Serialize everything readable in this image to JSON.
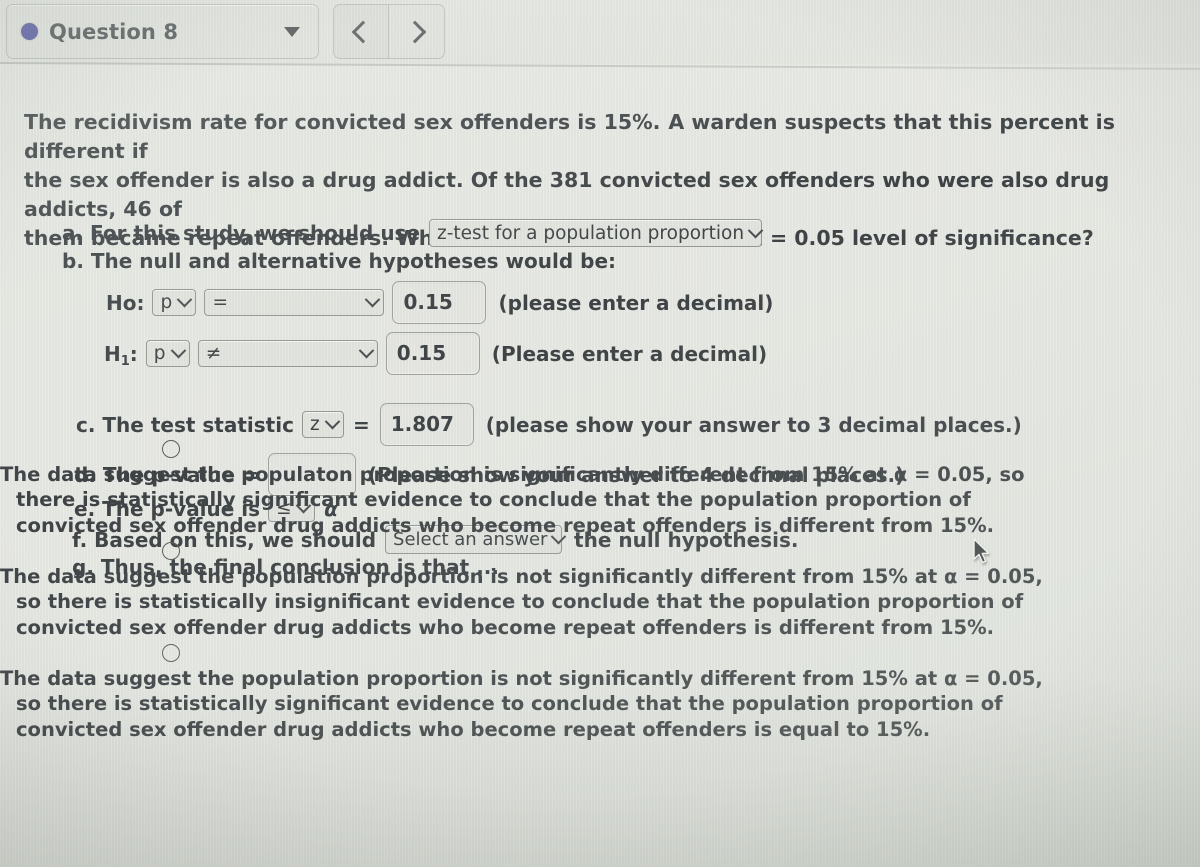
{
  "toolbar": {
    "question_label": "Question 8",
    "dot_color": "#3b3f96",
    "caret_icon": "chevron-down-icon",
    "prev_label": "‹",
    "next_label": "›"
  },
  "question": {
    "stem_line1": "The recidivism rate for convicted sex offenders is 15%.",
    "stem_line1b": "A warden suspects that this percent is different if",
    "stem_line2": "the sex offender is also a drug addict. Of the 381 convicted sex offenders who were also drug addicts, 46 of",
    "stem_line3": "them became repeat offenders. What can be concluded at the α = 0.05 level of significance?"
  },
  "parts": {
    "a": {
      "label": "a. For this study, we should use",
      "test_select_value": "z-test for a population proportion"
    },
    "b": {
      "label": "b. The null and alternative hypotheses would be:",
      "ho_label": "Ho:",
      "ho_param": "p",
      "ho_operator": "=",
      "ho_value": "0.15",
      "ho_hint": "(please enter a decimal)",
      "h1_label": "H",
      "h1_sub": "1",
      "h1_colon": ":",
      "h1_param": "p",
      "h1_operator": "≠",
      "h1_value": "0.15",
      "h1_hint": "(Please enter a decimal)"
    },
    "c": {
      "label": "c. The test statistic",
      "stat_select_value": "z",
      "equals": "=",
      "value": "1.807",
      "hint": "(please show your answer to 3 decimal places.)"
    },
    "d": {
      "label": "d. The p-value =",
      "value": "",
      "hint": "(Please show your answer to 4 decimal places.)"
    },
    "e": {
      "label": "e. The p-value is",
      "ineq_select_value": "≤",
      "alpha": "α"
    },
    "f": {
      "label_before": "f. Based on this, we should",
      "answer_select_value": "Select an answer",
      "label_after": "the null hypothesis."
    },
    "g": {
      "label": "g. Thus, the final conclusion is that ..."
    }
  },
  "choices": [
    {
      "line1_a": "The data suggest the populaton proportion is ",
      "line1_bold": "significantly",
      "line1_b": " different from 15% at α = 0.05, so",
      "line2": "there is statistically significant evidence to conclude that the population proportion of",
      "line3": "convicted sex offender drug addicts who become repeat offenders is different from 15%."
    },
    {
      "line1_a": "The data suggest the population proportion is not ",
      "line1_bold": "significantly",
      "line1_b": " different from 15% at α = 0.05,",
      "line2": "so there is statistically insignificant evidence to conclude that the population proportion of",
      "line3": "convicted sex offender drug addicts who become repeat offenders is different from 15%."
    },
    {
      "line1_a": "The data suggest the population proportion is not ",
      "line1_bold": "significantly",
      "line1_b": " different from 15% at α = 0.05,",
      "line2": "so there is statistically significant evidence to conclude that the population proportion of",
      "line3": "convicted sex offender drug addicts who become repeat offenders is equal to 15%."
    }
  ],
  "cursor": {
    "icon": "mouse-pointer-icon"
  }
}
